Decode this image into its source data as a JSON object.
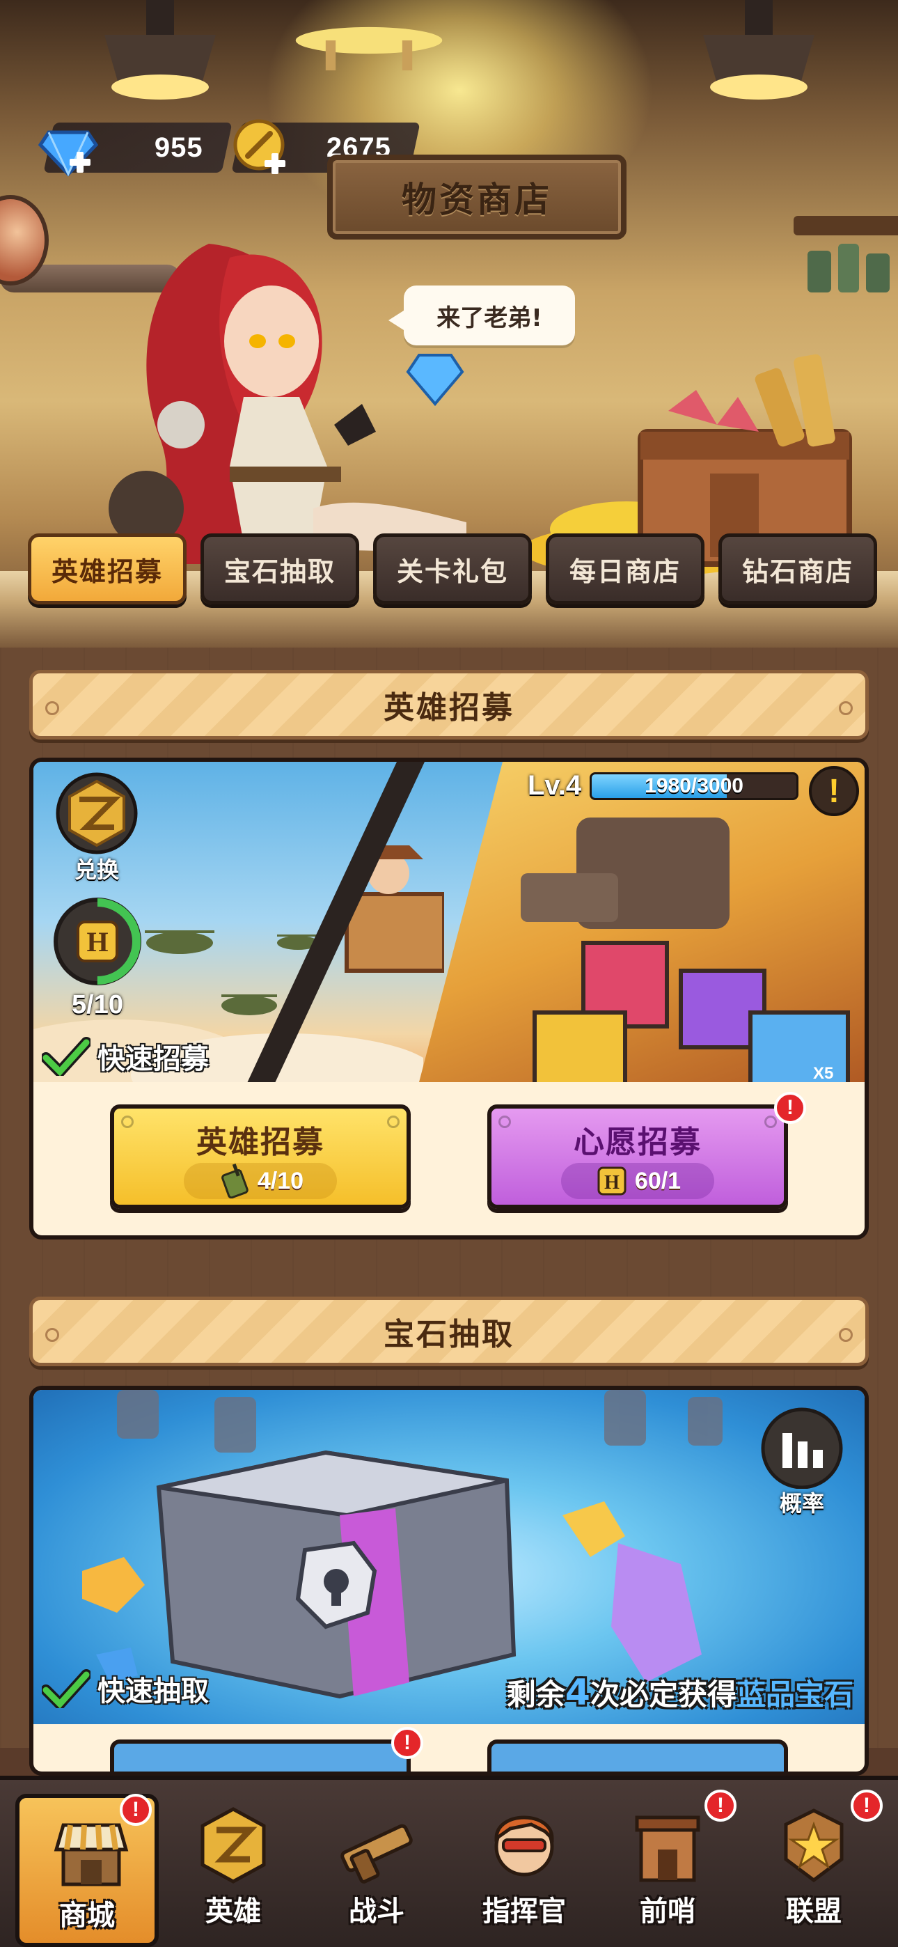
{
  "currencies": {
    "gems": "955",
    "gold": "2675"
  },
  "shop_sign": "物资商店",
  "speech_bubble": "来了老弟!",
  "tabs": [
    {
      "label": "英雄招募",
      "active": true
    },
    {
      "label": "宝石抽取",
      "active": false
    },
    {
      "label": "关卡礼包",
      "active": false
    },
    {
      "label": "每日商店",
      "active": false
    },
    {
      "label": "钻石商店",
      "active": false
    }
  ],
  "hero_recruit": {
    "header": "英雄招募",
    "exchange_label": "兑换",
    "h_progress": "5/10",
    "h_progress_fraction": 0.5,
    "quick_label": "快速招募",
    "level_label": "Lv.4",
    "level_progress": "1980/3000",
    "level_progress_fraction": 0.66,
    "buttons": {
      "hero": {
        "title": "英雄招募",
        "cost": "4/10"
      },
      "wish": {
        "title": "心愿招募",
        "cost": "60/1",
        "badge": "!"
      }
    },
    "factory_multiplier": "X5"
  },
  "gem_draw": {
    "header": "宝石抽取",
    "probability_label": "概率",
    "quick_label": "快速抽取",
    "remain_prefix": "剩余",
    "remain_count": "4",
    "remain_mid": "次必定获得",
    "remain_item": "蓝品宝石",
    "button_badge": "!"
  },
  "bottom_nav": [
    {
      "label": "商城",
      "icon": "shop-icon",
      "active": true,
      "badge": "!"
    },
    {
      "label": "英雄",
      "icon": "hero-emblem-icon",
      "active": false,
      "badge": ""
    },
    {
      "label": "战斗",
      "icon": "battle-gun-icon",
      "active": false,
      "badge": ""
    },
    {
      "label": "指挥官",
      "icon": "commander-icon",
      "active": false,
      "badge": ""
    },
    {
      "label": "前哨",
      "icon": "outpost-icon",
      "active": false,
      "badge": "!"
    },
    {
      "label": "联盟",
      "icon": "alliance-star-icon",
      "active": false,
      "badge": "!"
    }
  ],
  "colors": {
    "tab_active": "#f2a93a",
    "hero_button": "#f5bf2a",
    "wish_button": "#c05fdc",
    "level_bar": "#2aa0e8",
    "highlight_blue": "#56b7ff",
    "badge_red": "#e4262a"
  }
}
